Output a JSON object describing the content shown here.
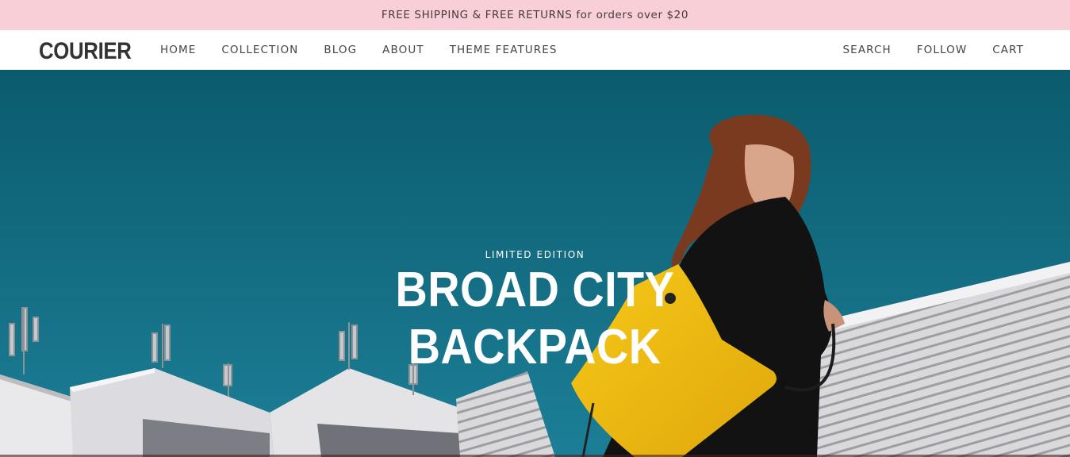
{
  "colors": {
    "announcement_bg": "#f9cfd7",
    "sky_top": "#0c5f70",
    "sky_bottom": "#1a7d95",
    "bag": "#f2be12",
    "text_light": "#ffffff"
  },
  "announcement": {
    "text": "FREE SHIPPING & FREE RETURNS for orders over $20"
  },
  "header": {
    "logo": "COURIER",
    "nav_left": [
      "HOME",
      "COLLECTION",
      "BLOG",
      "ABOUT",
      "THEME FEATURES"
    ],
    "nav_right": [
      "SEARCH",
      "FOLLOW",
      "CART"
    ]
  },
  "hero": {
    "eyebrow": "LIMITED EDITION",
    "title_line1": "BROAD CITY",
    "title_line2": "BACKPACK",
    "image_icon": "photo-woman-yellow-bag"
  }
}
